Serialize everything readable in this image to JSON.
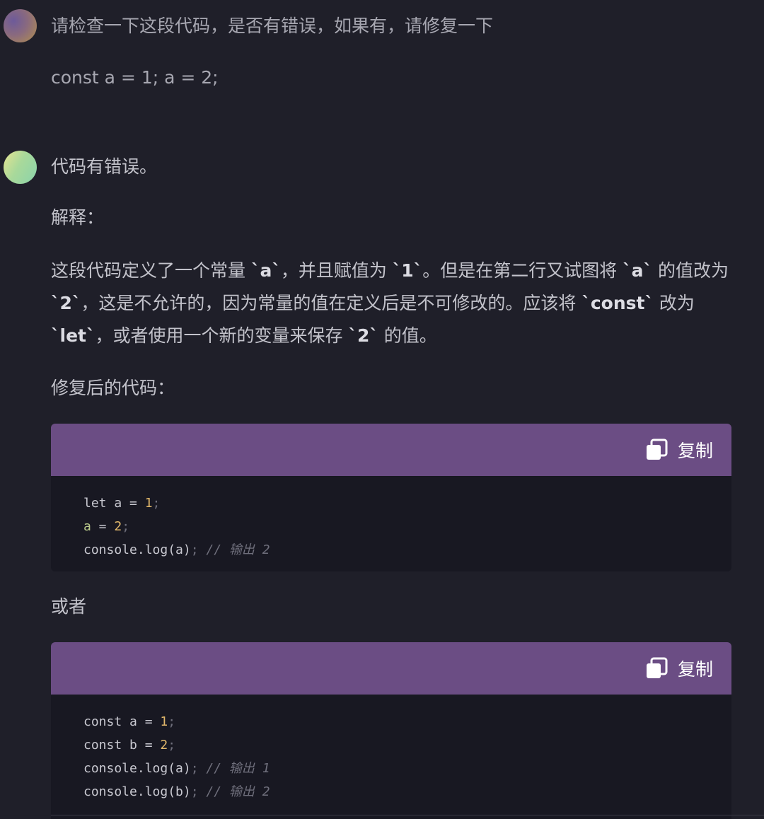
{
  "user": {
    "message": "请检查一下这段代码，是否有错误，如果有，请修复一下",
    "code": "const a = 1; a = 2;"
  },
  "answer": {
    "summary": "代码有错误。",
    "explain_label": "解释：",
    "explanation_lines": [
      [
        "这段代码定义了一个常量 ",
        "`a`",
        "，并且赋值为 ",
        "`1`",
        "。但是在第二行又试图将 ",
        "`a`",
        " 的值改为"
      ],
      [
        "`2`",
        "，这是不允许的，因为常量的值在定义后是不可修改的。应该将 ",
        "`const`",
        " 改为"
      ],
      [
        "`let`",
        "，或者使用一个新的变量来保存 ",
        "`2`",
        " 的值。"
      ]
    ],
    "fixed_label": "修复后的代码：",
    "or_label": "或者"
  },
  "code_blocks": [
    {
      "copy_label": "复制",
      "lines": [
        [
          [
            "kw",
            "let a = "
          ],
          [
            "num",
            "1"
          ],
          [
            "punc",
            ";"
          ]
        ],
        [
          [
            "var",
            "a"
          ],
          [
            "kw",
            " = "
          ],
          [
            "num",
            "2"
          ],
          [
            "punc",
            ";"
          ]
        ],
        [
          [
            "kw",
            "console.log(a)"
          ],
          [
            "punc",
            "; "
          ],
          [
            "comment",
            "// 输出 2"
          ]
        ]
      ]
    },
    {
      "copy_label": "复制",
      "lines": [
        [
          [
            "kw",
            "const a = "
          ],
          [
            "num",
            "1"
          ],
          [
            "punc",
            ";"
          ]
        ],
        [
          [
            "kw",
            "const b = "
          ],
          [
            "num",
            "2"
          ],
          [
            "punc",
            ";"
          ]
        ],
        [
          [
            "kw",
            "console.log(a)"
          ],
          [
            "punc",
            "; "
          ],
          [
            "comment",
            "// 输出 1"
          ]
        ],
        [
          [
            "kw",
            "console.log(b)"
          ],
          [
            "punc",
            "; "
          ],
          [
            "comment",
            "// 输出 2"
          ]
        ]
      ]
    }
  ],
  "colors": {
    "background": "#1f1f29",
    "code_header": "#6b4d84",
    "code_background": "#181822",
    "number": "#e2b86b",
    "variable": "#b9c98a",
    "comment": "#6f6f7c"
  },
  "icons": {
    "copy": "copy-icon"
  }
}
